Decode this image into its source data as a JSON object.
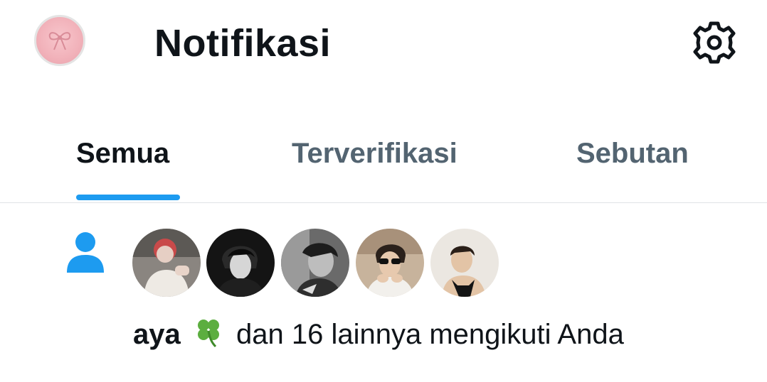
{
  "header": {
    "title": "Notifikasi",
    "avatar_icon": "bow-icon",
    "settings_icon": "gear-icon"
  },
  "tabs": [
    {
      "label": "Semua",
      "active": true
    },
    {
      "label": "Terverifikasi",
      "active": false
    },
    {
      "label": "Sebutan",
      "active": false
    }
  ],
  "notification": {
    "type_icon": "person-icon",
    "user": "aya",
    "user_emoji": "clover-icon",
    "message": "dan 16 lainnya mengikuti Anda",
    "avatar_count": 5
  },
  "colors": {
    "accent": "#1d9bf0",
    "text_primary": "#0f1419",
    "text_secondary": "#536471",
    "divider": "#dfe3e6"
  }
}
